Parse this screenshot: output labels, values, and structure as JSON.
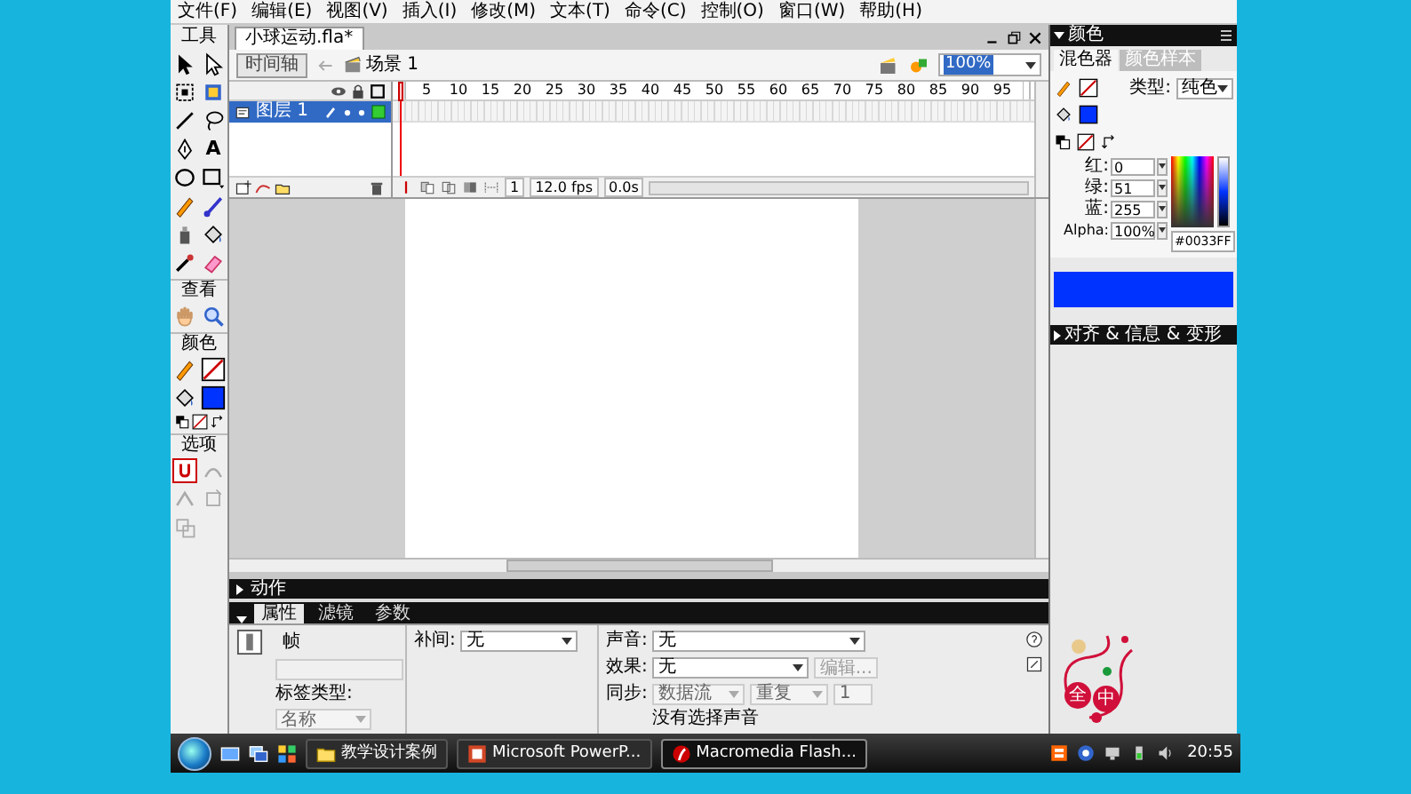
{
  "menu_bar": [
    "文件(F)",
    "编辑(E)",
    "视图(V)",
    "插入(I)",
    "修改(M)",
    "文本(T)",
    "命令(C)",
    "控制(O)",
    "窗口(W)",
    "帮助(H)"
  ],
  "tools": {
    "title": "工具",
    "text_tool_glyph": "A",
    "sections": [
      "查看",
      "颜色",
      "选项"
    ],
    "snap_to_objects": true
  },
  "document": {
    "tab": "小球运动.fla*",
    "timeline_button": "时间轴",
    "scene": "场景 1",
    "zoom": "100%"
  },
  "timeline": {
    "ruler": [
      "5",
      "10",
      "15",
      "20",
      "25",
      "30",
      "35",
      "40",
      "45",
      "50",
      "55",
      "60",
      "65",
      "70",
      "75",
      "80",
      "85",
      "90",
      "95"
    ],
    "layers": [
      {
        "name": "图层 1",
        "selected": true
      }
    ],
    "current_frame": "1",
    "frame_rate": "12.0 fps",
    "elapsed": "0.0s"
  },
  "actions_panel": {
    "title": "动作",
    "expanded": false
  },
  "properties_panel": {
    "expanded": true,
    "tabs": [
      {
        "label": "属性",
        "selected": true
      },
      {
        "label": "滤镜",
        "selected": false
      },
      {
        "label": "参数",
        "selected": false
      }
    ],
    "frame_label": "帧",
    "frame_name": {
      "disabled": true
    },
    "label_type_label": "标签类型:",
    "label_type": {
      "value": "名称",
      "disabled": true
    },
    "tween_label": "补间:",
    "tween": {
      "value": "无",
      "disabled": false
    },
    "sound_label": "声音:",
    "sound": {
      "value": "无",
      "disabled": false
    },
    "effect_label": "效果:",
    "effect": {
      "value": "无",
      "disabled": false
    },
    "edit_button": {
      "label": "编辑...",
      "disabled": true
    },
    "sync_label": "同步:",
    "sync": {
      "value": "数据流",
      "disabled": true
    },
    "repeat": {
      "value": "重复",
      "disabled": true
    },
    "repeat_count": {
      "value": "1",
      "disabled": true
    },
    "sound_status": "没有选择声音"
  },
  "color_panel": {
    "title": "颜色",
    "expanded": true,
    "tabs": [
      {
        "label": "混色器",
        "selected": true
      },
      {
        "label": "颜色样本",
        "selected": false
      }
    ],
    "type_label": "类型:",
    "type": "纯色",
    "channels": [
      {
        "label": "红:",
        "value": "0"
      },
      {
        "label": "绿:",
        "value": "51"
      },
      {
        "label": "蓝:",
        "value": "255"
      },
      {
        "label": "Alpha:",
        "value": "100%"
      }
    ],
    "hex": "#0033FF"
  },
  "align_panel": {
    "title": "对齐 & 信息 & 变形",
    "expanded": false
  },
  "ime_widget": {
    "labels": [
      "全",
      "中"
    ]
  },
  "taskbar": {
    "items": [
      {
        "label": "教学设计案例",
        "kind": "folder",
        "active": false
      },
      {
        "label": "Microsoft PowerP...",
        "kind": "powerpoint",
        "active": false
      },
      {
        "label": "Macromedia Flash...",
        "kind": "flash",
        "active": true
      }
    ],
    "clock": "20:55"
  }
}
